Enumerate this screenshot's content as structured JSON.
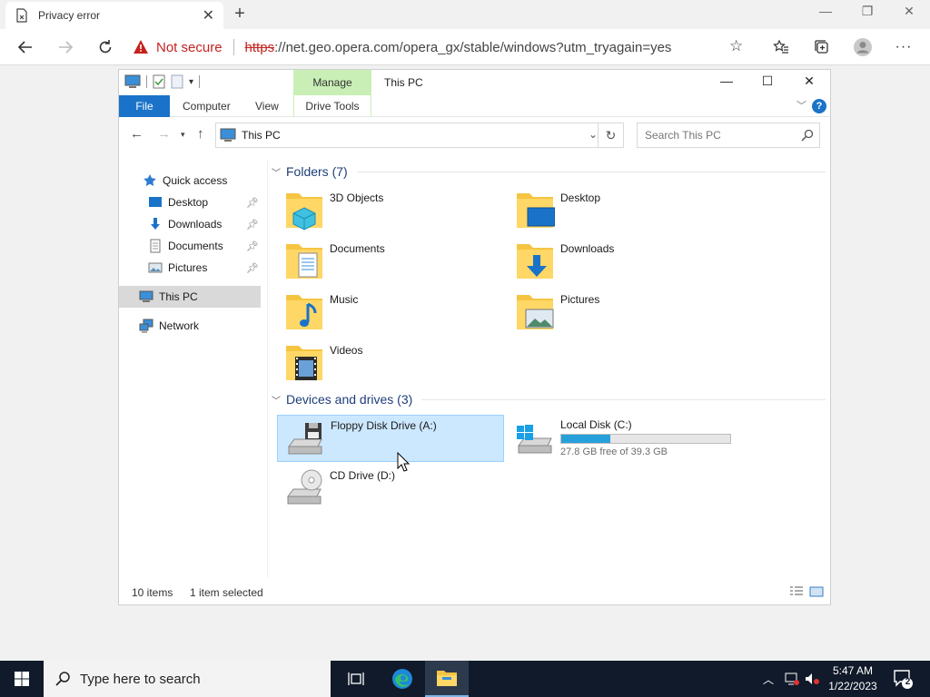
{
  "browser": {
    "tab_title": "Privacy error",
    "security_label": "Not secure",
    "url_scheme": "https",
    "url_rest": "://net.geo.opera.com/opera_gx/stable/windows?utm_tryagain=yes"
  },
  "explorer": {
    "title": "This PC",
    "manage_label": "Manage",
    "ribbon_tabs": {
      "file": "File",
      "computer": "Computer",
      "view": "View",
      "drive_tools": "Drive Tools"
    },
    "path": "This PC",
    "search_placeholder": "Search This PC",
    "nav": {
      "quick_access": "Quick access",
      "desktop": "Desktop",
      "downloads": "Downloads",
      "documents": "Documents",
      "pictures": "Pictures",
      "this_pc": "This PC",
      "network": "Network"
    },
    "folders_header": "Folders (7)",
    "folders": [
      "3D Objects",
      "Desktop",
      "Documents",
      "Downloads",
      "Music",
      "Pictures",
      "Videos"
    ],
    "devices_header": "Devices and drives (3)",
    "drives": {
      "floppy": "Floppy Disk Drive (A:)",
      "local": "Local Disk (C:)",
      "local_free": "27.8 GB free of 39.3 GB",
      "local_used_fraction": 0.293,
      "cd": "CD Drive (D:)"
    },
    "status": {
      "count": "10 items",
      "selected": "1 item selected"
    }
  },
  "taskbar": {
    "search_placeholder": "Type here to search",
    "time": "5:47 AM",
    "date": "1/22/2023",
    "notif_count": "2"
  },
  "colors": {
    "accent": "#1a73c8",
    "selection_bg": "#cce8ff",
    "manage_bg": "#c9efb6",
    "not_secure": "#c5221f",
    "taskbar": "#101a2a",
    "disk_fill": "#26a0da"
  }
}
